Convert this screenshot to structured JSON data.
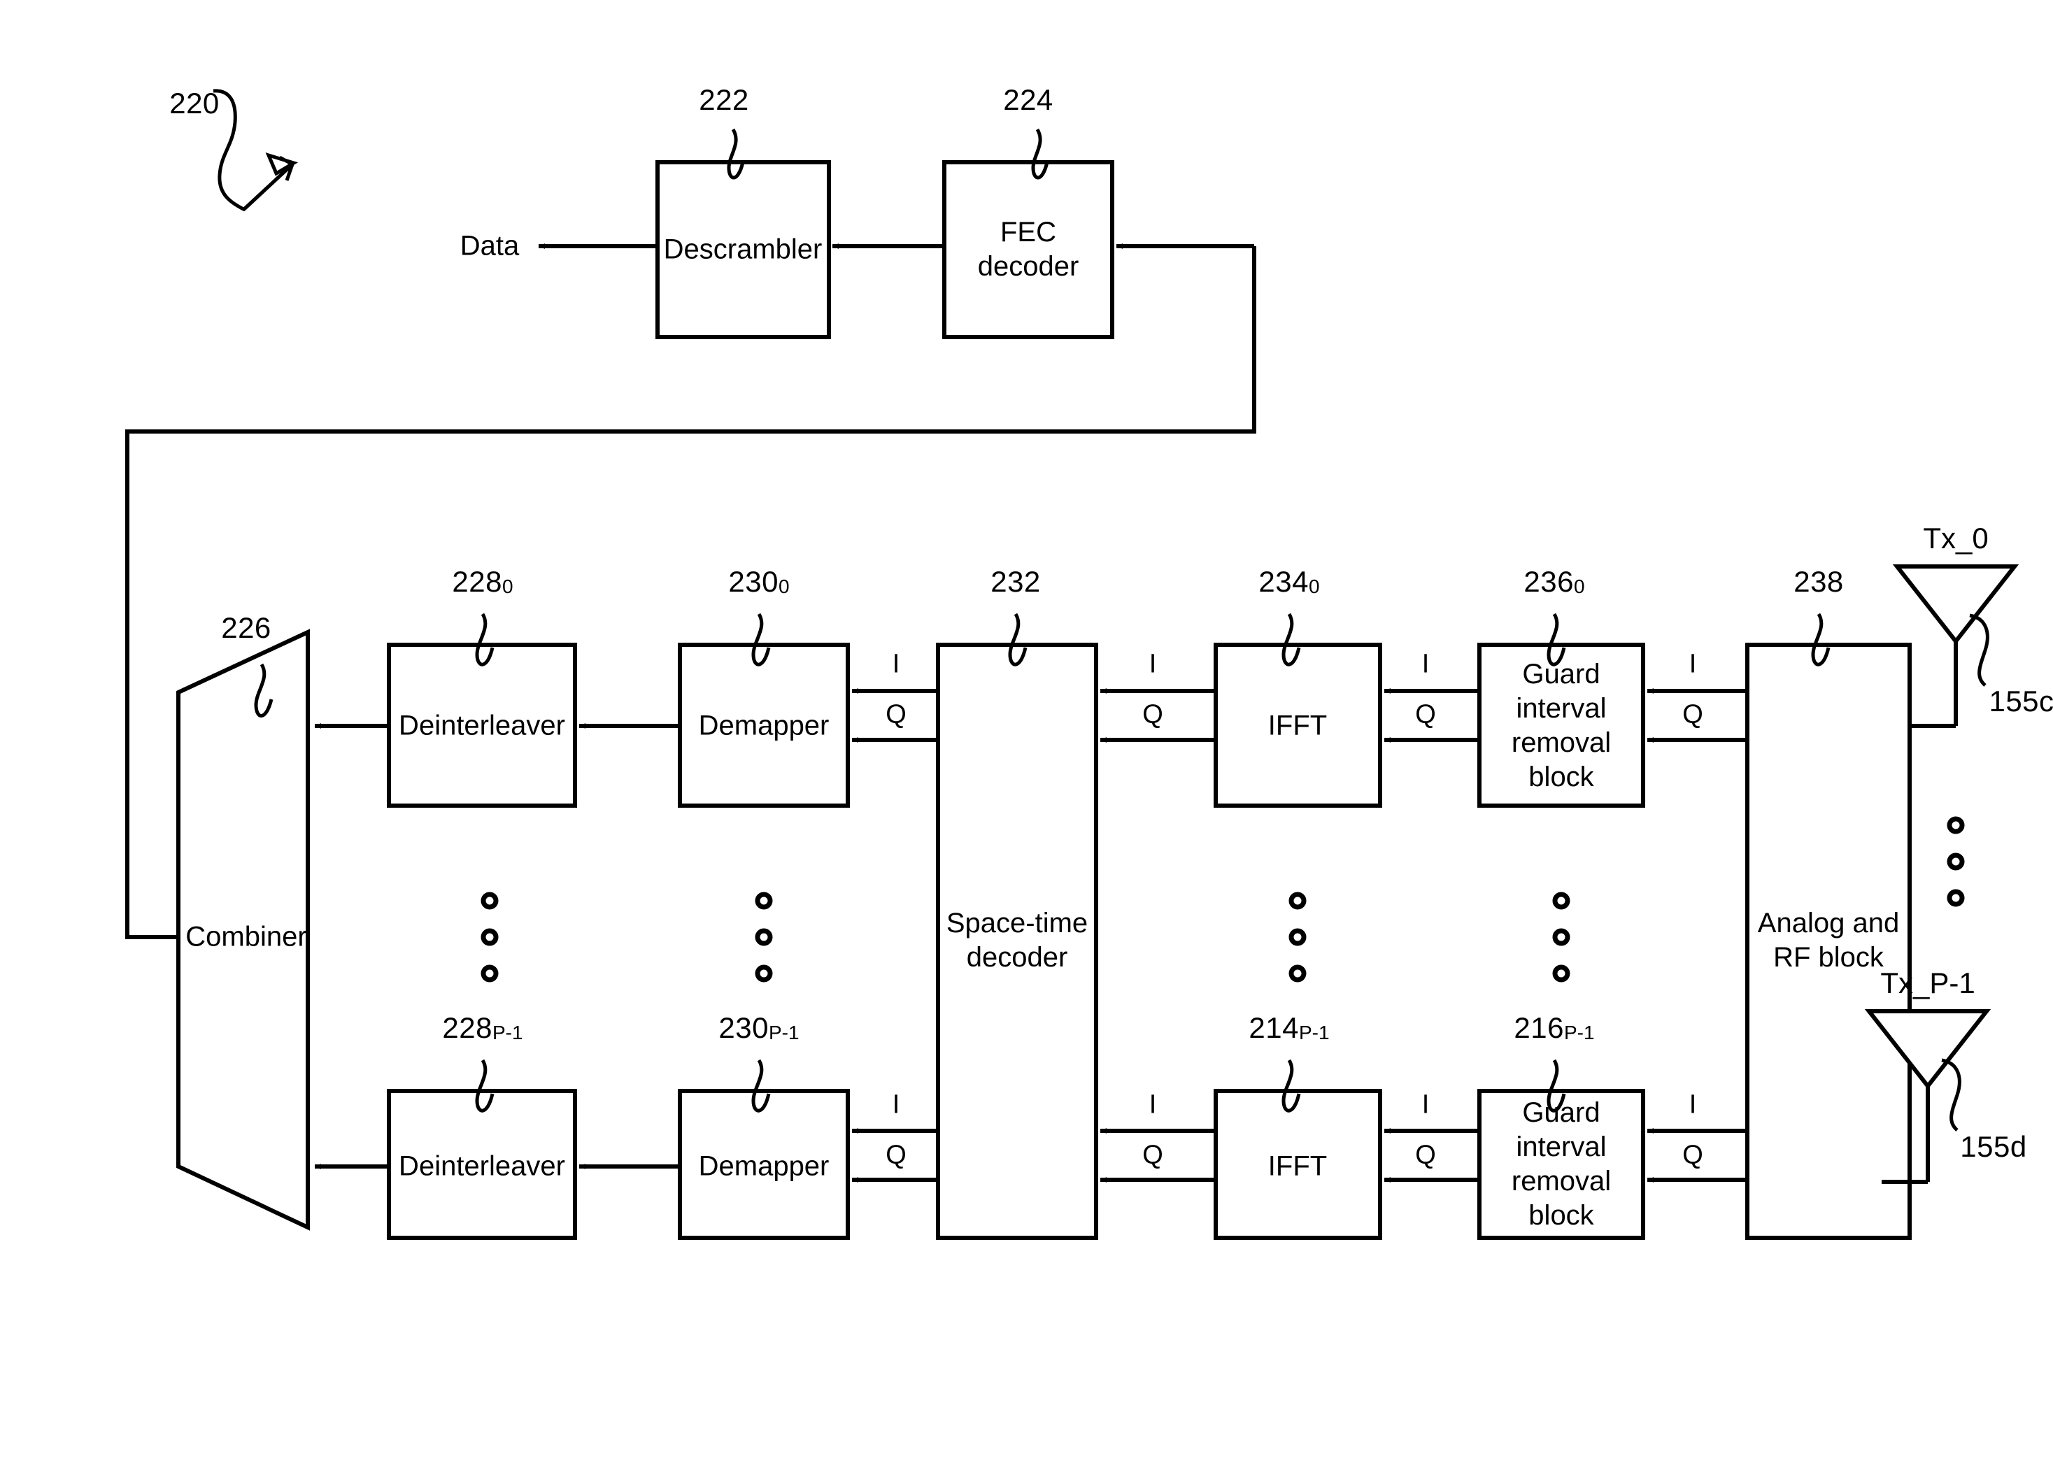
{
  "figure": {
    "ref": "220",
    "io": {
      "data_label": "Data"
    }
  },
  "top_chain": {
    "blocks": [
      {
        "id": "descrambler",
        "label": "Descrambler",
        "ref": "222"
      },
      {
        "id": "fec-decoder",
        "label": "FEC\ndecoder",
        "ref": "224"
      }
    ]
  },
  "combiner": {
    "label": "Combiner",
    "ref": "226"
  },
  "branches": [
    {
      "id": "branch-0",
      "deinterleaver": {
        "label": "Deinterleaver",
        "ref": "228",
        "sub": "0"
      },
      "demapper": {
        "label": "Demapper",
        "ref": "230",
        "sub": "0"
      },
      "ifft": {
        "label": "IFFT",
        "ref": "234",
        "sub": "0"
      },
      "guard": {
        "label": "Guard\ninterval\nremoval\nblock",
        "ref": "236",
        "sub": "0"
      },
      "signals": {
        "i": "I",
        "q": "Q"
      }
    },
    {
      "id": "branch-p-1",
      "deinterleaver": {
        "label": "Deinterleaver",
        "ref": "228",
        "sub": "P-1"
      },
      "demapper": {
        "label": "Demapper",
        "ref": "230",
        "sub": "P-1"
      },
      "ifft": {
        "label": "IFFT",
        "ref": "214",
        "sub": "P-1"
      },
      "guard": {
        "label": "Guard\ninterval\nremoval\nblock",
        "ref": "216",
        "sub": "P-1"
      },
      "signals": {
        "i": "I",
        "q": "Q"
      }
    }
  ],
  "space_time_decoder": {
    "label": "Space-time\ndecoder",
    "ref": "232"
  },
  "analog_rf": {
    "label": "Analog and\nRF block",
    "ref": "238"
  },
  "antennas": [
    {
      "id": "tx-0",
      "name": "Tx_0",
      "ref": "155c"
    },
    {
      "id": "tx-p-1",
      "name": "Tx_P-1",
      "ref": "155d"
    }
  ],
  "ellipses": {
    "glyph": "o",
    "count": 3
  },
  "colors": {
    "stroke": "#000000",
    "background": "#ffffff"
  }
}
